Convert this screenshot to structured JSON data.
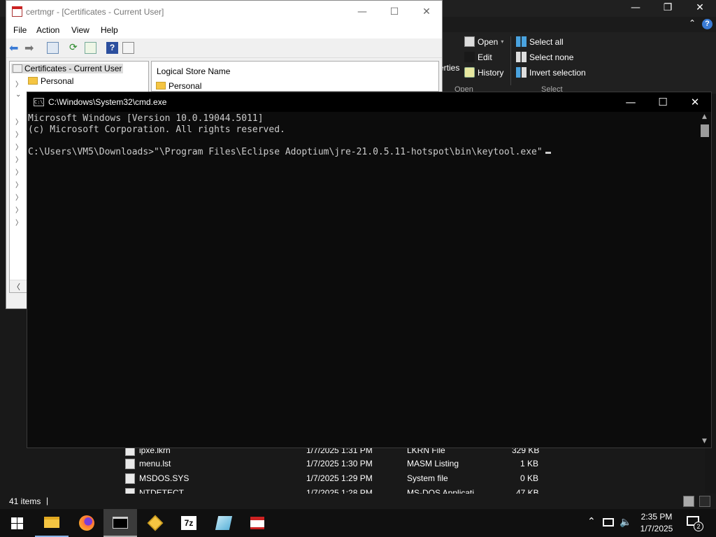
{
  "explorer": {
    "ribbon": {
      "open_label": "Open",
      "edit_label": "Edit",
      "history_label": "History",
      "properties_partial": "erties",
      "select_all_label": "Select all",
      "select_none_label": "Select none",
      "invert_selection_label": "Invert selection",
      "group_open": "Open",
      "group_select": "Select"
    },
    "files": [
      {
        "name": "ipxe.lkrn",
        "date": "1/7/2025 1:31 PM",
        "type": "LKRN File",
        "size": "329 KB"
      },
      {
        "name": "menu.lst",
        "date": "1/7/2025 1:30 PM",
        "type": "MASM Listing",
        "size": "1 KB"
      },
      {
        "name": "MSDOS.SYS",
        "date": "1/7/2025 1:29 PM",
        "type": "System file",
        "size": "0 KB"
      },
      {
        "name": "NTDETECT",
        "date": "1/7/2025 1:28 PM",
        "type": "MS-DOS Applicati",
        "size": "47 KB"
      }
    ],
    "status": {
      "items_count": "41 items",
      "separator": "|"
    }
  },
  "certmgr": {
    "title": "certmgr - [Certificates - Current User]",
    "menu": [
      "File",
      "Action",
      "View",
      "Help"
    ],
    "tree_root": "Certificates - Current User",
    "tree_first_child": "Personal",
    "list_header": "Logical Store Name",
    "list_first_item": "Personal"
  },
  "cmd": {
    "title": "C:\\Windows\\System32\\cmd.exe",
    "lines": [
      "Microsoft Windows [Version 10.0.19044.5011]",
      "(c) Microsoft Corporation. All rights reserved.",
      "",
      "C:\\Users\\VM5\\Downloads>\"\\Program Files\\Eclipse Adoptium\\jre-21.0.5.11-hotspot\\bin\\keytool.exe\""
    ]
  },
  "taskbar": {
    "time": "2:35 PM",
    "date": "1/7/2025",
    "notification_count": "2"
  },
  "colors": {
    "taskbar": "#101010",
    "cmd_background": "#0c0c0c",
    "cmd_text": "#cccccc",
    "select_icon_blue": "#4aa3df",
    "folder_yellow": "#f5c542"
  }
}
